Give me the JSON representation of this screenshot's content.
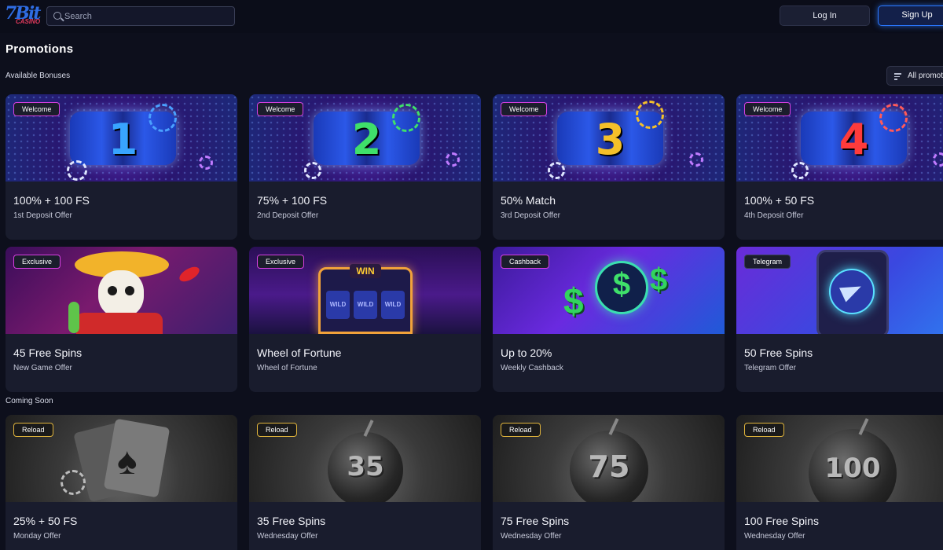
{
  "app": {
    "logo_top": "7Bit",
    "logo_bottom": "CASINO"
  },
  "header": {
    "search_placeholder": "Search",
    "login_label": "Log In",
    "signup_label": "Sign Up"
  },
  "page": {
    "title": "Promotions",
    "available_label": "Available Bonuses",
    "coming_soon_label": "Coming Soon",
    "filter_label": "All promotions"
  },
  "available": [
    {
      "badge": "Welcome",
      "title": "100% + 100 FS",
      "subtitle": "1st Deposit Offer",
      "reel_number": "1"
    },
    {
      "badge": "Welcome",
      "title": "75% + 100 FS",
      "subtitle": "2nd Deposit Offer",
      "reel_number": "2"
    },
    {
      "badge": "Welcome",
      "title": "50% Match",
      "subtitle": "3rd Deposit Offer",
      "reel_number": "3"
    },
    {
      "badge": "Welcome",
      "title": "100% + 50 FS",
      "subtitle": "4th Deposit Offer",
      "reel_number": "4"
    },
    {
      "badge": "Exclusive",
      "title": "45 Free Spins",
      "subtitle": "New Game Offer"
    },
    {
      "badge": "Exclusive",
      "title": "Wheel of Fortune",
      "subtitle": "Wheel of Fortune",
      "art_text": "WIN",
      "reel_text": "WILD"
    },
    {
      "badge": "Cashback",
      "title": "Up to 20%",
      "subtitle": "Weekly Cashback"
    },
    {
      "badge": "Telegram",
      "title": "50 Free Spins",
      "subtitle": "Telegram Offer"
    }
  ],
  "coming_soon": [
    {
      "badge": "Reload",
      "title": "25% + 50 FS",
      "subtitle": "Monday Offer"
    },
    {
      "badge": "Reload",
      "title": "35 Free Spins",
      "subtitle": "Wednesday Offer",
      "bomb_number": "35"
    },
    {
      "badge": "Reload",
      "title": "75 Free Spins",
      "subtitle": "Wednesday Offer",
      "bomb_number": "75"
    },
    {
      "badge": "Reload",
      "title": "100 Free Spins",
      "subtitle": "Wednesday Offer",
      "bomb_number": "100"
    }
  ],
  "colors": {
    "background": "#0d0f1c",
    "card": "#191c2d",
    "accent_blue": "#2a78ff",
    "badge_pink": "#d640e0",
    "badge_gold": "#e0b43c"
  },
  "icons": {
    "search": "search-icon",
    "filter": "filter-icon"
  }
}
